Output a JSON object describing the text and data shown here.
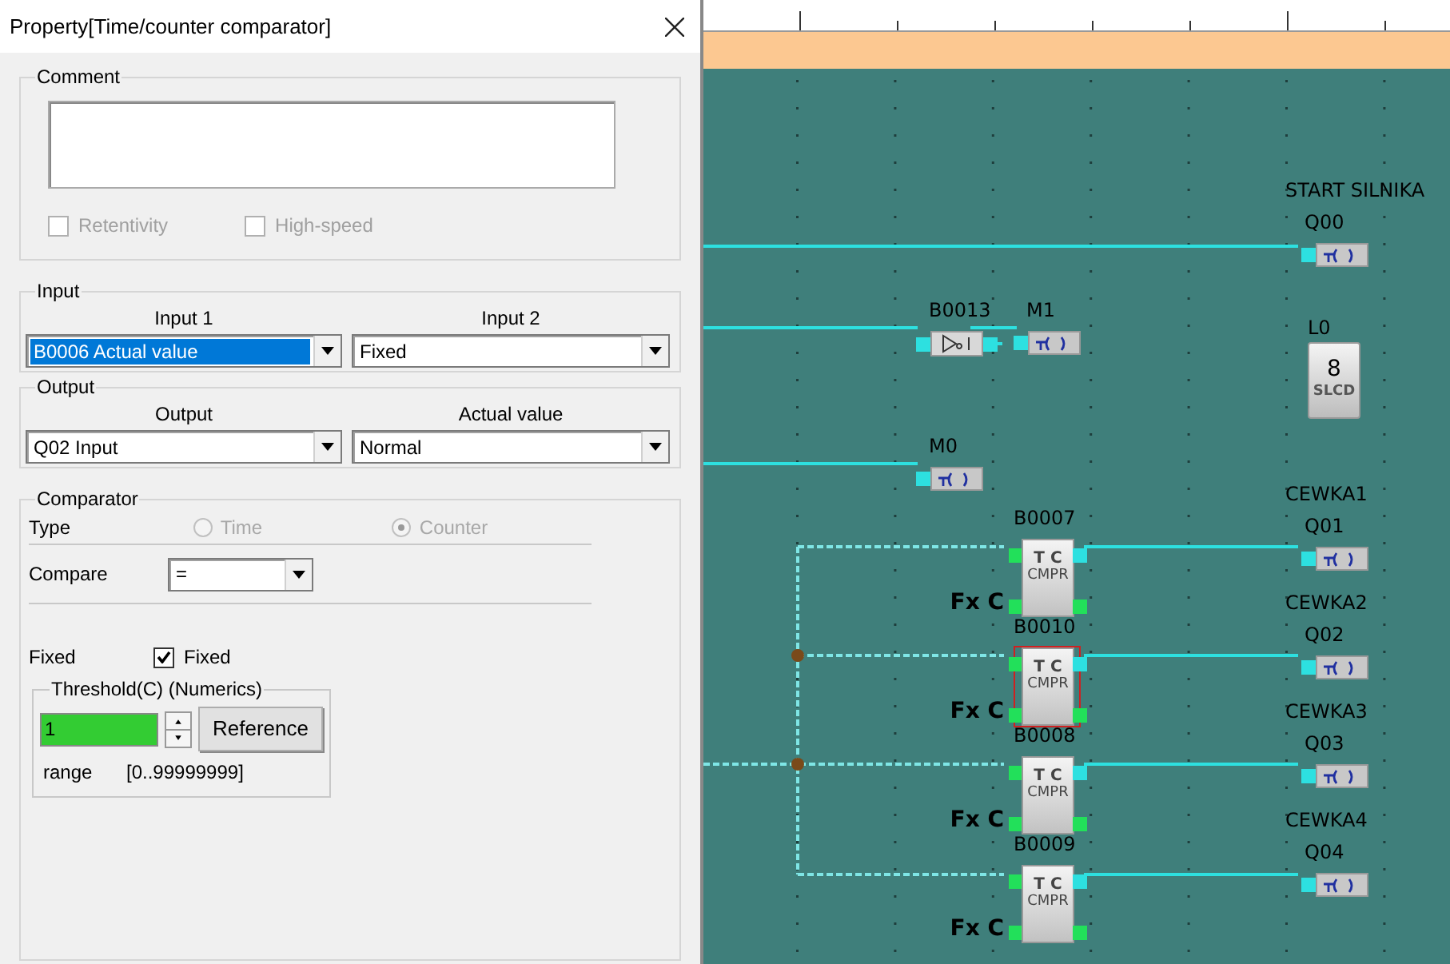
{
  "dialog": {
    "title": "Property[Time/counter comparator]",
    "comment": {
      "legend": "Comment",
      "options": [
        {
          "label": "Retentivity",
          "checked": false,
          "disabled": true
        },
        {
          "label": "High-speed",
          "checked": false,
          "disabled": true
        }
      ]
    },
    "input": {
      "legend": "Input",
      "fields": [
        {
          "label": "Input 1",
          "value": "B0006  Actual value",
          "selected": true
        },
        {
          "label": "Input 2",
          "value": "Fixed",
          "selected": false
        }
      ]
    },
    "output": {
      "legend": "Output",
      "fields": [
        {
          "label": "Output",
          "value": "Q02  Input",
          "selected": false
        },
        {
          "label": "Actual value",
          "value": "Normal",
          "selected": false
        }
      ]
    },
    "comparator": {
      "legend": "Comparator",
      "type_label": "Type",
      "types": [
        {
          "label": "Time",
          "selected": false,
          "disabled": true
        },
        {
          "label": "Counter",
          "selected": true,
          "disabled": true
        }
      ],
      "compare_label": "Compare",
      "compare_value": "=",
      "fixed_label": "Fixed",
      "fixed_checkbox": {
        "label": "Fixed",
        "checked": true
      },
      "threshold": {
        "legend": "Threshold(C) (Numerics)",
        "value": "1",
        "button": "Reference",
        "range_label": "range",
        "range": "[0..99999999]"
      }
    }
  },
  "diagram": {
    "elements": [
      {
        "kind": "output",
        "comment": "START SILNIKA",
        "label": "Q00"
      },
      {
        "kind": "not",
        "label": "B0013"
      },
      {
        "kind": "coil",
        "label": "M1"
      },
      {
        "kind": "display",
        "label": "L0",
        "digit": "8",
        "text": "SLCD"
      },
      {
        "kind": "coil",
        "label": "M0"
      },
      {
        "kind": "comparator",
        "label": "B0007",
        "symbol": "T C",
        "text": "CMPR",
        "input_label": "Fx C",
        "selected": false
      },
      {
        "kind": "output",
        "comment": "CEWKA1",
        "label": "Q01"
      },
      {
        "kind": "comparator",
        "label": "B0010",
        "symbol": "T C",
        "text": "CMPR",
        "input_label": "Fx C",
        "selected": true
      },
      {
        "kind": "output",
        "comment": "CEWKA2",
        "label": "Q02"
      },
      {
        "kind": "comparator",
        "label": "B0008",
        "symbol": "T C",
        "text": "CMPR",
        "input_label": "Fx C",
        "selected": false
      },
      {
        "kind": "output",
        "comment": "CEWKA3",
        "label": "Q03"
      },
      {
        "kind": "comparator",
        "label": "B0009",
        "symbol": "T C",
        "text": "CMPR",
        "input_label": "Fx C",
        "selected": false
      },
      {
        "kind": "output",
        "comment": "CEWKA4",
        "label": "Q04"
      }
    ]
  }
}
